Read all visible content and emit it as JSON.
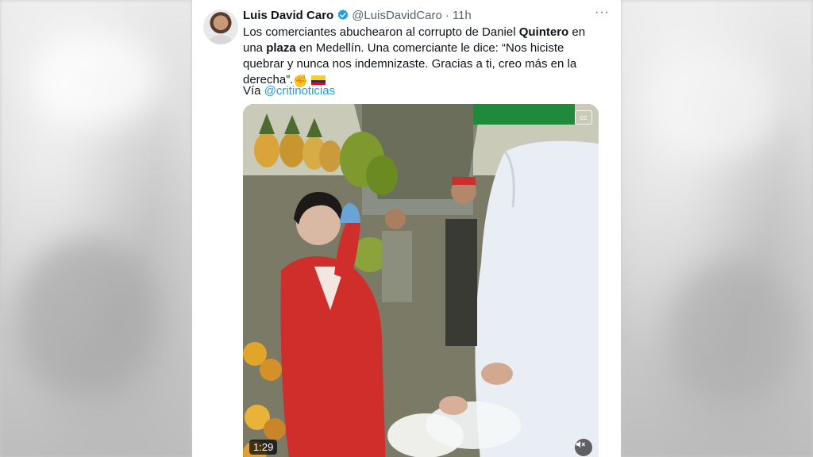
{
  "tweet": {
    "author_name": "Luis David Caro",
    "handle": "@LuisDavidCaro",
    "separator": "·",
    "time": "11h",
    "text": {
      "p1": "Los comerciantes abuchearon al corrupto de Daniel ",
      "b1": "Quintero",
      "p2": " en una ",
      "b2": "plaza",
      "p3": " en Medellín. Una comerciante le dice: “Nos hiciste quebrar y nunca nos indemnizaste. Gracias a ti, creo más en la derecha”.",
      "emoji_fist": "✊",
      "emoji_flag": "🇨🇴"
    },
    "via_label": "Vía",
    "via_link": "@critinoticias",
    "more_label": "···",
    "video_duration": "1:29"
  },
  "icons": {
    "verified": "verified-badge-icon",
    "more": "more-options-icon",
    "mute": "mute-icon",
    "captions": "captions-icon"
  },
  "colors": {
    "link": "#1d9bf0",
    "text": "#0f1419",
    "secondary": "#536471",
    "verified": "#1d9bf0"
  }
}
